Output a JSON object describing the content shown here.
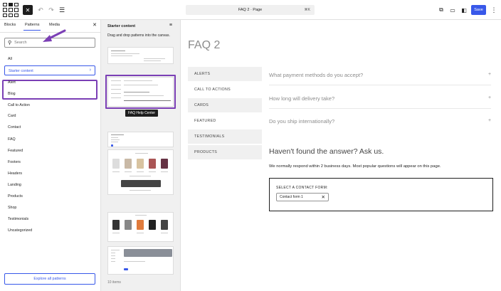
{
  "topbar": {
    "document_title": "FAQ 2 · Page",
    "shortcut": "⌘K",
    "save_label": "Save"
  },
  "inserter": {
    "tabs": [
      "Blocks",
      "Patterns",
      "Media"
    ],
    "search_placeholder": "Search",
    "categories": [
      "All",
      "Starter content",
      "Alert",
      "Blog",
      "Call to Action",
      "Card",
      "Contact",
      "FAQ",
      "Featured",
      "Footers",
      "Headers",
      "Landing",
      "Products",
      "Shop",
      "Testimonials",
      "Uncategorized"
    ],
    "selected_category": "Starter content",
    "explore_label": "Explore all patterns"
  },
  "patterns": {
    "title": "Starter content",
    "description": "Drag and drop patterns into the canvas.",
    "tooltip": "FAQ Help Center",
    "count": "10 items"
  },
  "canvas": {
    "page_title": "FAQ 2",
    "nav_items": [
      "ALERTS",
      "CALL TO ACTIONS",
      "CARDS",
      "FEATURED",
      "TESTIMONIALS",
      "PRODUCTS"
    ],
    "questions": [
      "What payment methods do you accept?",
      "How long will delivery take?",
      "Do you ship internationally?"
    ],
    "cta_title": "Haven't found the answer? Ask us.",
    "cta_text": "We normally respond within 2 business days. Most popular questions will appear on this page.",
    "form_label": "SELECT A CONTACT FORM:",
    "form_value": "Contact form 1"
  },
  "colors": {
    "accent": "#3858e9",
    "annotation": "#7b3fb5"
  }
}
